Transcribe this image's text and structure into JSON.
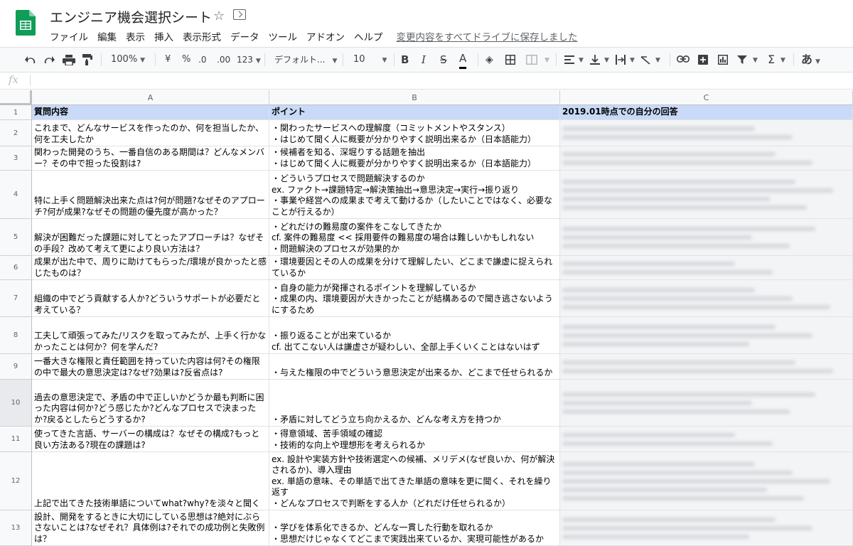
{
  "app": {
    "title": "エンジニア機会選択シート",
    "menus": [
      "ファイル",
      "編集",
      "表示",
      "挿入",
      "表示形式",
      "データ",
      "ツール",
      "アドオン",
      "ヘルプ"
    ],
    "save_status": "変更内容をすべてドライブに保存しました"
  },
  "toolbar": {
    "zoom": "100%",
    "currency": "¥",
    "percent": "%",
    "dec_less": ".0",
    "dec_more": ".00",
    "format_more": "123",
    "font": "デフォルト...",
    "font_size": "10",
    "bold": "B",
    "italic": "I",
    "strike": "S",
    "text_color": "A",
    "input_tools": "あ"
  },
  "formula_bar": {
    "fx": "fx",
    "value": ""
  },
  "columns": [
    "A",
    "B",
    "C"
  ],
  "rows": [
    {
      "num": "1",
      "a": "質問内容",
      "b": "ポイント",
      "c": "2019.01時点での自分の回答"
    },
    {
      "num": "2",
      "a": "これまで、どんなサービスを作ったのか、何を担当したか、何を工夫したか",
      "b": "・関わったサービスへの理解度（コミットメントやスタンス）\n・はじめて聞く人に概要が分かりやすく説明出来るか（日本語能力）",
      "c": ""
    },
    {
      "num": "3",
      "a": "関わった開発のうち、一番自信のある期間は？どんなメンバー？その中で担った役割は?",
      "b": "・候補者を知る、深堀りする話題を抽出\n・はじめて聞く人に概要が分かりやすく説明出来るか（日本語能力）",
      "c": ""
    },
    {
      "num": "4",
      "a": "特に上手く問題解決出来た点は?何が問題?なぜそのアプローチ?何が成果?なぜその問題の優先度が高かった？",
      "b": "・どういうプロセスで問題解決するのか\nex. ファクト→課題特定→解決策抽出→意思決定→実行→振り返り\n・事業や経営への成果まで考えて動けるか（したいことではなく、必要なことが行えるか）",
      "c": ""
    },
    {
      "num": "5",
      "a": "解決が困難だった課題に対してとったアプローチは？なぜその手段？改めて考えて更により良い方法は？",
      "b": "・どれだけの難易度の案件をこなしてきたか\ncf. 案件の難易度 << 採用要件の難易度の場合は難しいかもしれない\n・問題解決のプロセスが効果的か",
      "c": ""
    },
    {
      "num": "6",
      "a": "成果が出た中で、周りに助けてもらった/環境が良かったと感じたものは？",
      "b": "・環境要因とその人の成果を分けて理解したい、どこまで謙虚に捉えられているか",
      "c": ""
    },
    {
      "num": "7",
      "a": "組織の中でどう貢献する人か?どういうサポートが必要だと考えている？",
      "b": "・自身の能力が発揮されるポイントを理解しているか\n・成果の内、環境要因が大きかったことが結構あるので聞き逃さないようにするため",
      "c": ""
    },
    {
      "num": "8",
      "a": "工夫して頑張ってみた/リスクを取ってみたが、上手く行かなかったことは何か？何を学んだ?",
      "b": "・振り返ることが出来ているか\ncf. 出てこない人は謙虚さが疑わしい、全部上手くいくことはないはず",
      "c": ""
    },
    {
      "num": "9",
      "a": "一番大きな権限と責任範囲を持っていた内容は何?その権限の中で最大の意思決定は?なぜ?効果は?反省点は?",
      "b": "・与えた権限の中でどういう意思決定が出来るか、どこまで任せられるか",
      "c": ""
    },
    {
      "num": "10",
      "a": "過去の意思決定で、矛盾の中で正しいかどうか最も判断に困った内容は何か?どう感じたか?どんなプロセスで決まったか?戻るとしたらどうするか?",
      "b": "・矛盾に対してどう立ち向かえるか、どんな考え方を持つか",
      "c": ""
    },
    {
      "num": "11",
      "a": "使ってきた言語、サーバーの構成は？なぜその構成?もっと良い方法ある?現在の課題は?",
      "b": "・得意領域、苦手領域の確認\n・技術的な向上や理想形を考えられるか",
      "c": ""
    },
    {
      "num": "12",
      "a": "上記で出てきた技術単語についてwhat?why?を淡々と聞く",
      "b": "ex. 設計や実装方針や技術選定への候補、メリデメ(なぜ良いか、何が解決されるか)、導入理由\nex. 単語の意味、その単語で出てきた単語の意味を更に聞く、それを繰り返す\n・どんなプロセスで判断をする人か（どれだけ任せられるか）",
      "c": ""
    },
    {
      "num": "13",
      "a": "設計、開発をするときに大切にしている思想は?絶対にぶらさないことは?なぜそれ？具体例は?それでの成功例と失敗例は？",
      "b": "・学びを体系化できるか、どんな一貫した行動を取れるか\n・思想だけじゃなくてどこまで実践出来ているか、実現可能性があるか",
      "c": ""
    }
  ]
}
